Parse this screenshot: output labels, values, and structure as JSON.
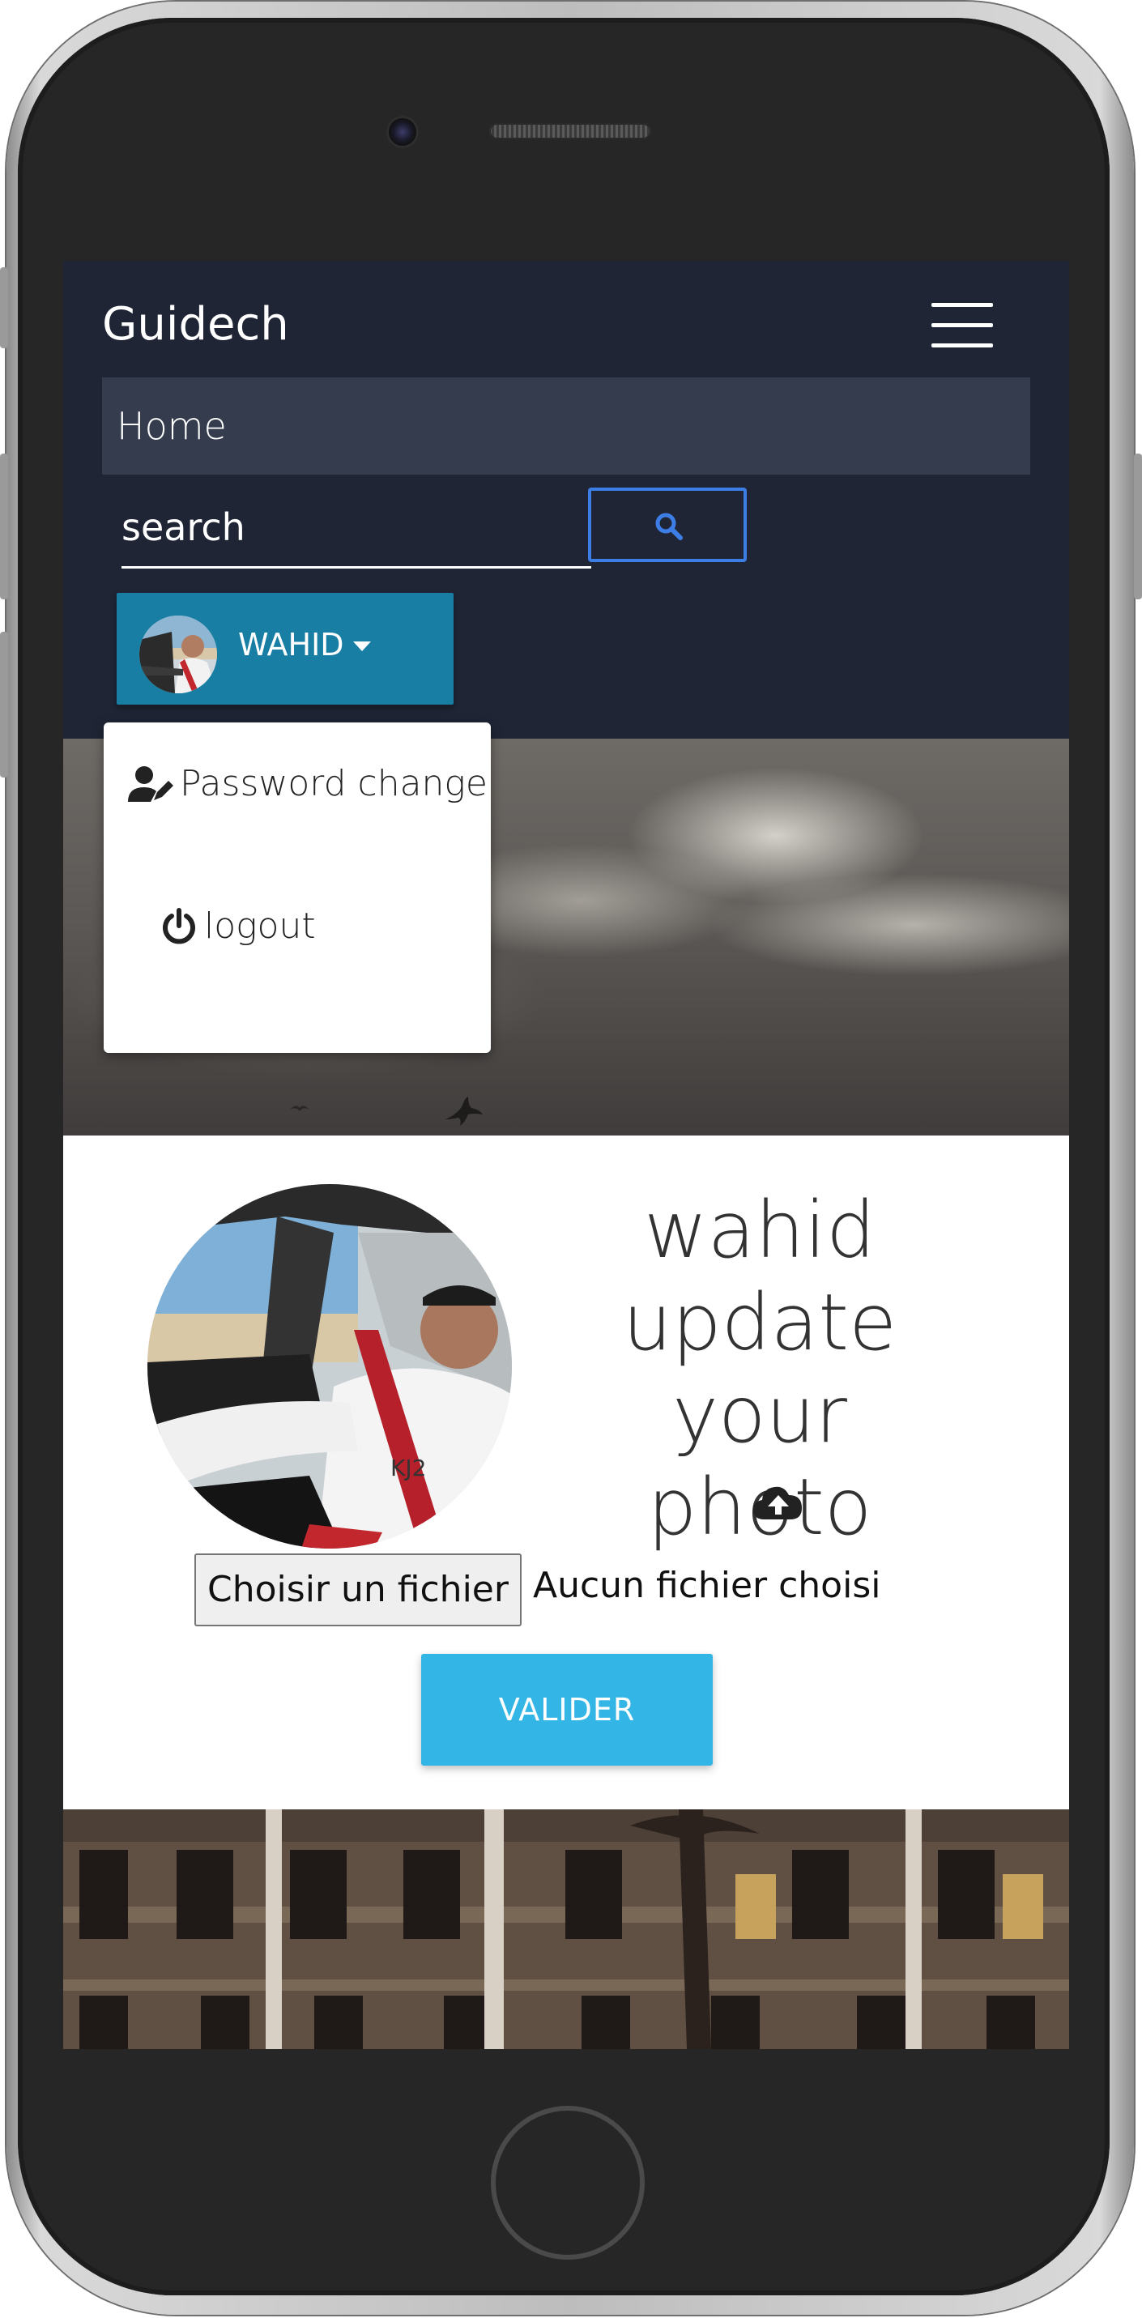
{
  "navbar": {
    "brand": "Guidech",
    "menu_items": [
      {
        "label": "Home"
      }
    ],
    "search": {
      "placeholder": "search",
      "value": ""
    },
    "user": {
      "name": "WAHID"
    }
  },
  "dropdown": {
    "items": [
      {
        "label": "Password change",
        "icon": "user-edit-icon"
      },
      {
        "label": "logout",
        "icon": "power-icon"
      }
    ]
  },
  "profile": {
    "headline": "wahid update your photo",
    "file_input": {
      "button_label": "Choisir un fichier",
      "status": "Aucun fichier choisi"
    },
    "submit_label": "VALIDER"
  },
  "colors": {
    "navbar_bg": "#1f2535",
    "home_item_bg": "#353c4d",
    "search_border": "#3d7ee6",
    "user_button": "#197ea4",
    "submit_button": "#33b5e5"
  }
}
